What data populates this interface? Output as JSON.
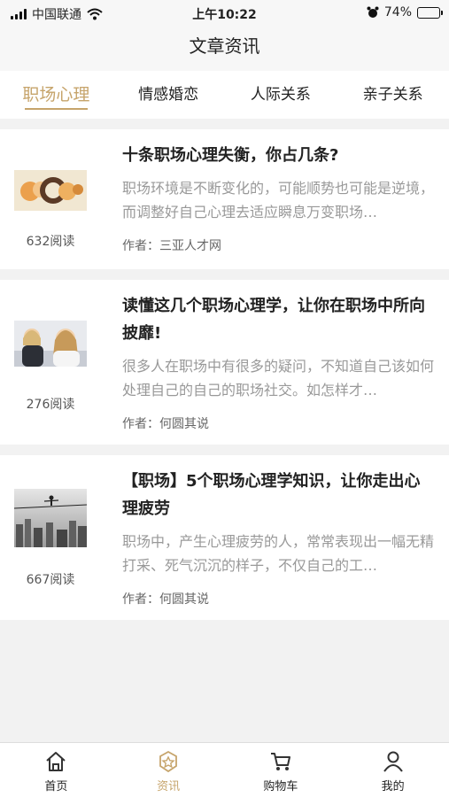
{
  "status_bar": {
    "carrier": "中国联通",
    "time": "上午10:22",
    "battery": "74%",
    "battery_level": 0.74
  },
  "nav": {
    "title": "文章资讯"
  },
  "tabs": [
    {
      "label": "职场心理",
      "active": true
    },
    {
      "label": "情感婚恋",
      "active": false
    },
    {
      "label": "人际关系",
      "active": false
    },
    {
      "label": "亲子关系",
      "active": false
    }
  ],
  "articles": [
    {
      "title": "十条职场心理失衡，你占几条?",
      "summary": "职场环境是不断变化的，可能顺势也可能是逆境，而调整好自己心理去适应瞬息万变职场…",
      "author": "作者：三亚人才网",
      "reads": "632阅读"
    },
    {
      "title": "读懂这几个职场心理学，让你在职场中所向披靡!",
      "summary": "很多人在职场中有很多的疑问，不知道自己该如何处理自己的自己的职场社交。如怎样才…",
      "author": "作者：何圆其说",
      "reads": "276阅读"
    },
    {
      "title": "【职场】5个职场心理学知识，让你走出心理疲劳",
      "summary": "职场中，产生心理疲劳的人，常常表现出一幅无精打采、死气沉沉的样子，不仅自己的工…",
      "author": "作者：何圆其说",
      "reads": "667阅读"
    }
  ],
  "tabbar": [
    {
      "label": "首页",
      "icon": "home-icon",
      "active": false
    },
    {
      "label": "资讯",
      "icon": "badge-icon",
      "active": true
    },
    {
      "label": "购物车",
      "icon": "cart-icon",
      "active": false
    },
    {
      "label": "我的",
      "icon": "person-icon",
      "active": false
    }
  ],
  "colors": {
    "accent": "#c6a46b",
    "background": "#f2f2f2"
  }
}
